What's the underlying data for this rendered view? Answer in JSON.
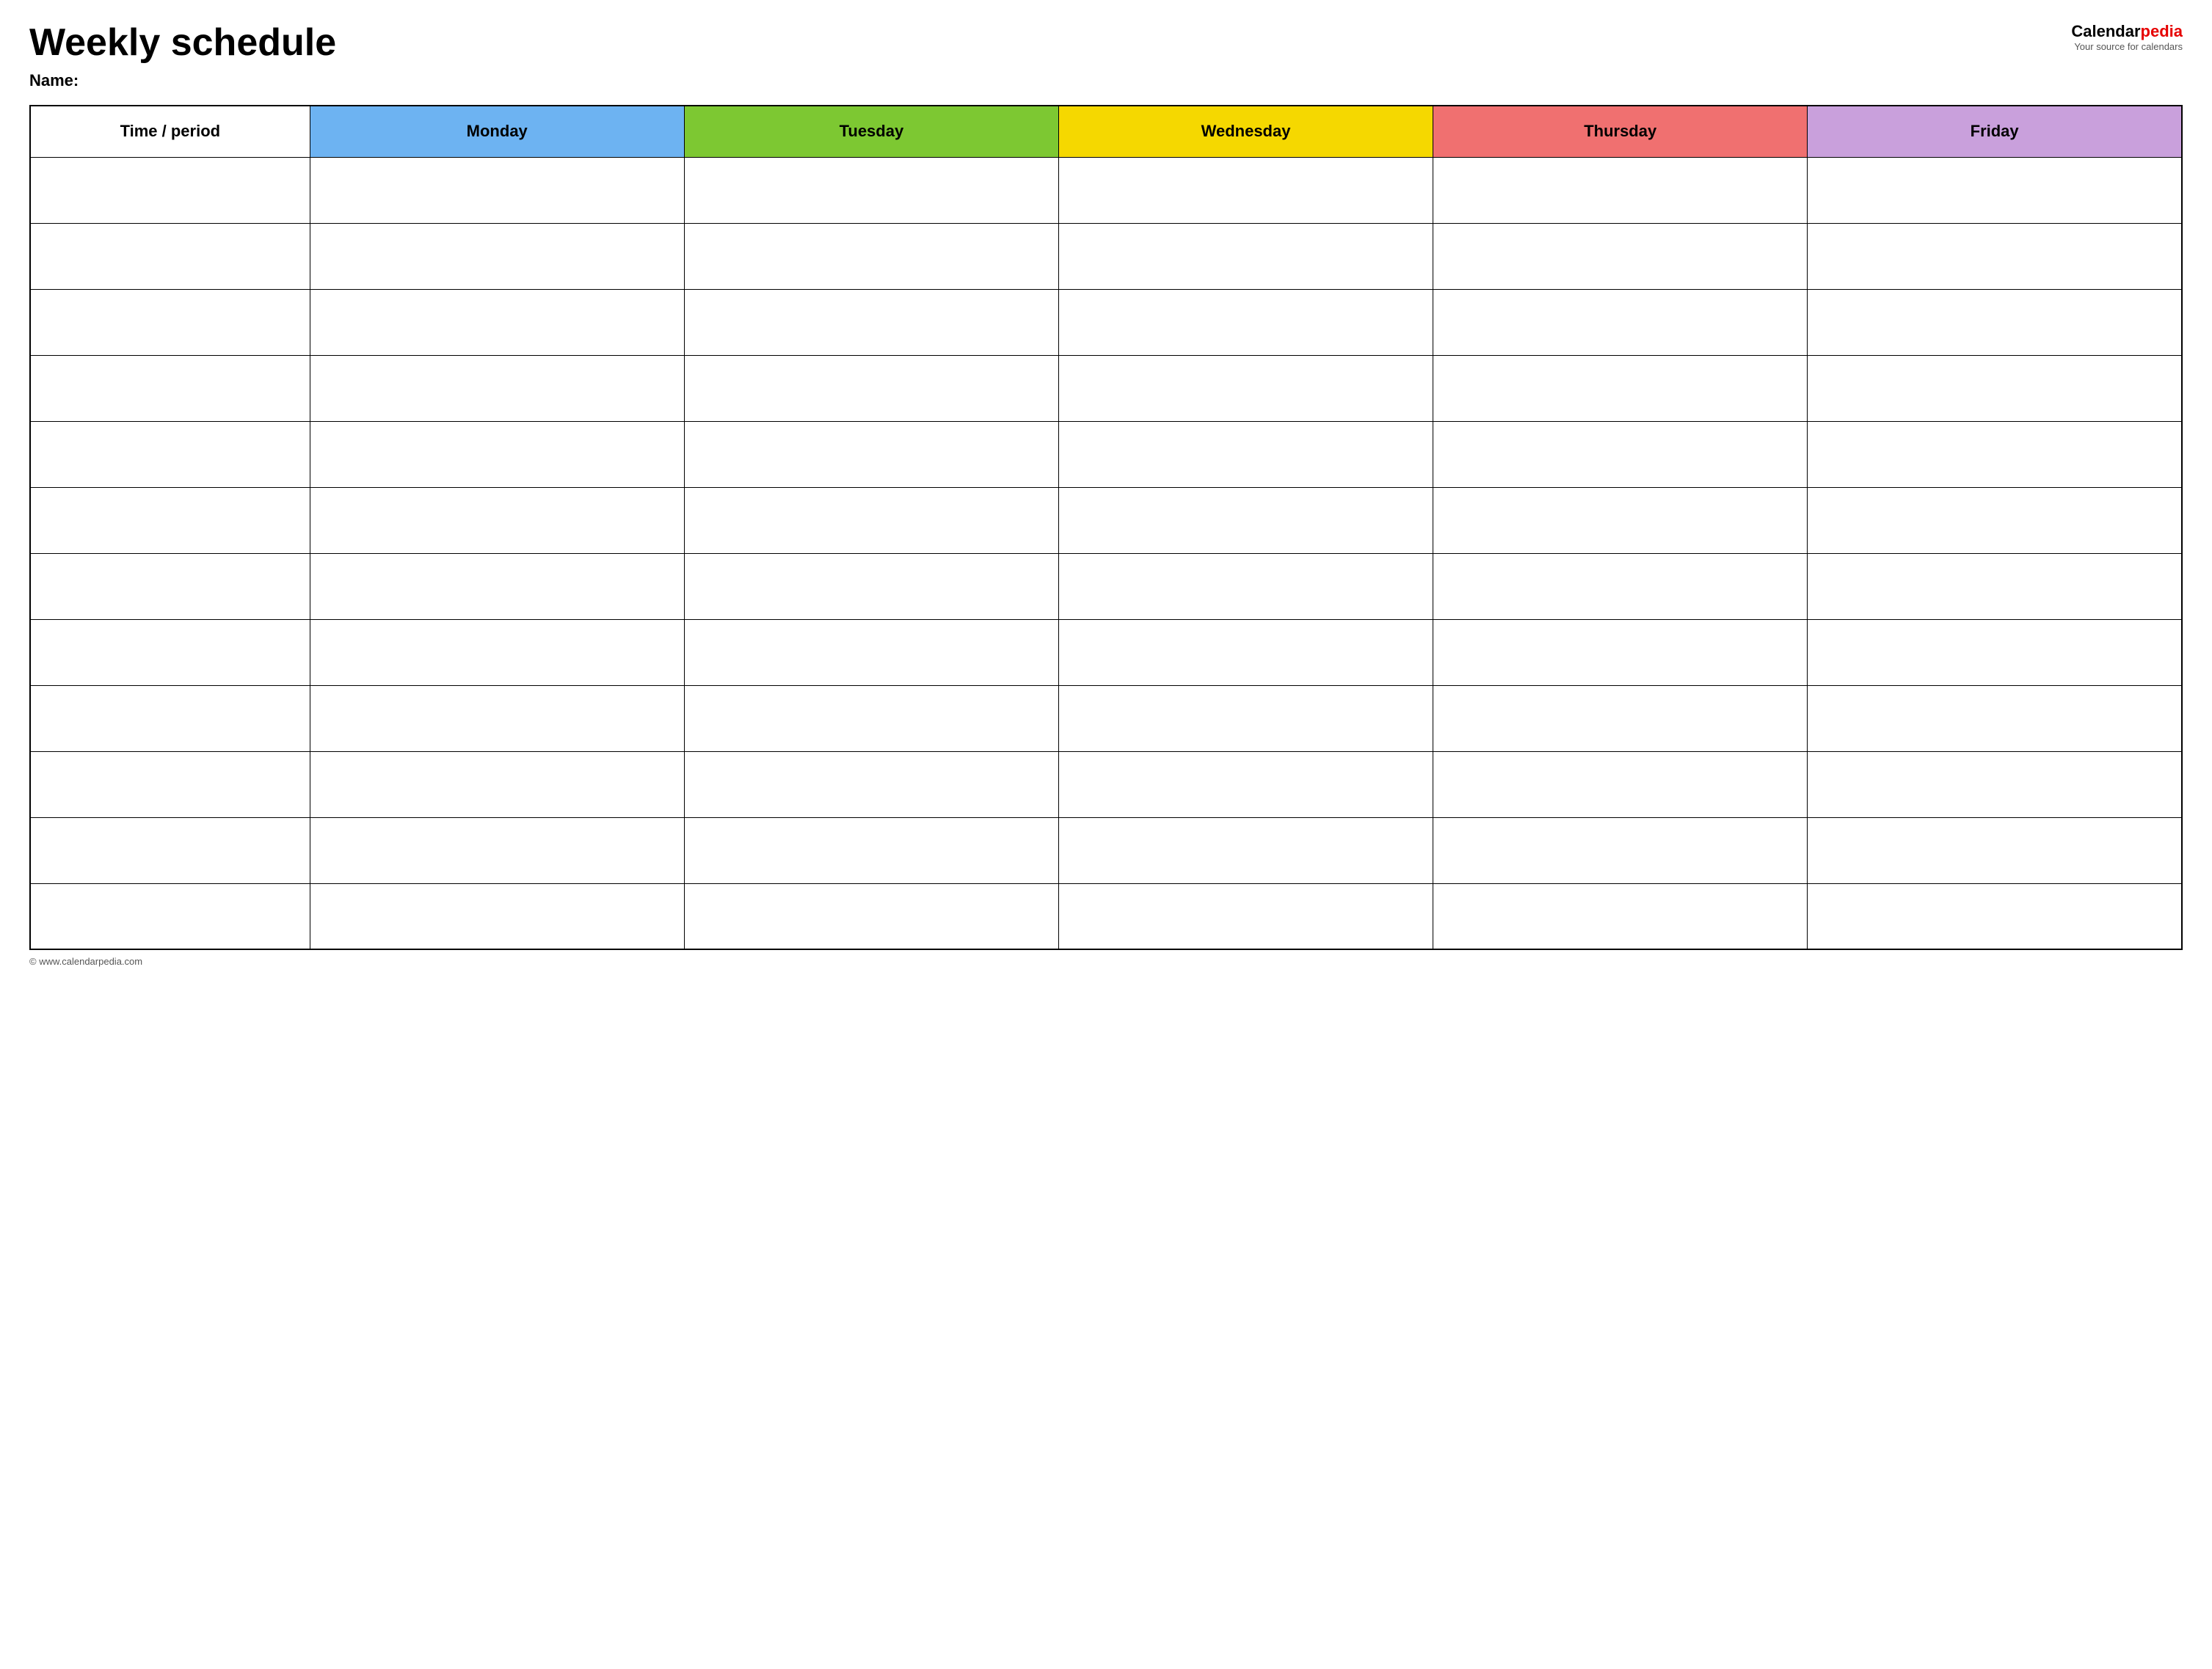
{
  "header": {
    "title": "Weekly schedule",
    "name_label": "Name:",
    "logo": {
      "calendar": "Calendar",
      "pedia": "pedia",
      "tagline": "Your source for calendars"
    }
  },
  "table": {
    "columns": [
      {
        "id": "time",
        "label": "Time / period",
        "color": "#ffffff"
      },
      {
        "id": "monday",
        "label": "Monday",
        "color": "#6db3f2"
      },
      {
        "id": "tuesday",
        "label": "Tuesday",
        "color": "#7dc832"
      },
      {
        "id": "wednesday",
        "label": "Wednesday",
        "color": "#f5d800"
      },
      {
        "id": "thursday",
        "label": "Thursday",
        "color": "#f07070"
      },
      {
        "id": "friday",
        "label": "Friday",
        "color": "#c9a0dc"
      }
    ],
    "row_count": 12
  },
  "footer": {
    "url": "© www.calendarpedia.com"
  }
}
